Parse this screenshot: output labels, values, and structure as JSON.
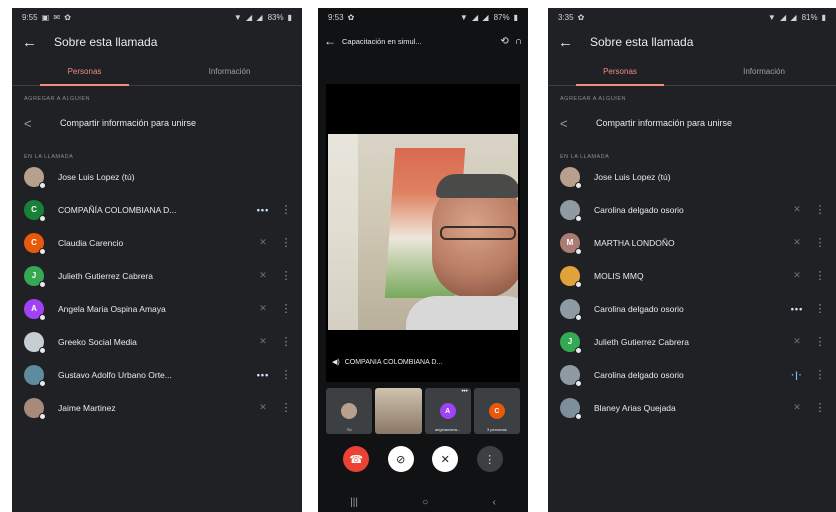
{
  "colors": {
    "background": "#202124",
    "accent": "#f28b82",
    "end_call": "#ea4335",
    "speaking": "#8ab4f8"
  },
  "left": {
    "status": {
      "time": "9:55",
      "battery": "83%"
    },
    "title": "Sobre esta llamada",
    "tabs": [
      "Personas",
      "Información"
    ],
    "add_label": "AGREGAR A ALGUIEN",
    "share_text": "Compartir información para unirse",
    "in_call_label": "EN LA LLAMADA",
    "participants": [
      {
        "name": "Jose Luis Lopez (tú)",
        "initial": "",
        "color": "#b7a08e",
        "status": "",
        "icon": "photo-avatar"
      },
      {
        "name": "COMPAÑÍA COLOMBIANA D...",
        "initial": "C",
        "color": "#188038",
        "status": "•••",
        "icon": "speaking-dots-icon"
      },
      {
        "name": "Claudia Carencio",
        "initial": "C",
        "color": "#e8590c",
        "status": "✕",
        "icon": "mic-off-icon"
      },
      {
        "name": "Julieth Gutierrez Cabrera",
        "initial": "J",
        "color": "#34a853",
        "status": "✕",
        "icon": "mic-off-icon"
      },
      {
        "name": "Angela Maria Ospina Amaya",
        "initial": "A",
        "color": "#a142f4",
        "status": "✕",
        "icon": "mic-off-icon"
      },
      {
        "name": "Greeko Social Media",
        "initial": "",
        "color": "#c7cdd3",
        "status": "✕",
        "icon": "mic-off-icon"
      },
      {
        "name": "Gustavo Adolfo Urbano Orte...",
        "initial": "",
        "color": "#5f8b9e",
        "status": "•••",
        "icon": "speaking-dots-icon"
      },
      {
        "name": "Jaime Martinez",
        "initial": "",
        "color": "#a78a7a",
        "status": "✕",
        "icon": "mic-off-icon"
      }
    ]
  },
  "mid": {
    "status": {
      "time": "9:53",
      "battery": "87%"
    },
    "title": "Capacitación en simul...",
    "video_label": "COMPAÑÍA COLOMBIANA D...",
    "thumbs": [
      {
        "label": "Tú"
      },
      {
        "label": ""
      },
      {
        "initial": "A",
        "color": "#a142f4",
        "label": "angelamaria..."
      },
      {
        "initial": "C",
        "color": "#e8590c",
        "label": "3 personas"
      }
    ]
  },
  "right": {
    "status": {
      "time": "3:35",
      "battery": "81%"
    },
    "title": "Sobre esta llamada",
    "tabs": [
      "Personas",
      "Información"
    ],
    "add_label": "AGREGAR A ALGUIEN",
    "share_text": "Compartir información para unirse",
    "in_call_label": "EN LA LLAMADA",
    "participants": [
      {
        "name": "Jose Luis Lopez (tú)",
        "initial": "",
        "color": "#b7a08e",
        "status": "",
        "icon": "photo-avatar"
      },
      {
        "name": "Carolina delgado osorio",
        "initial": "",
        "color": "#8f9ba3",
        "status": "✕",
        "icon": "mic-off-icon"
      },
      {
        "name": "MARTHA LONDOÑO",
        "initial": "M",
        "color": "#a97d73",
        "status": "✕",
        "icon": "mic-off-icon"
      },
      {
        "name": "MOLIS MMQ",
        "initial": "",
        "color": "#e0a33a",
        "status": "✕",
        "icon": "mic-off-icon"
      },
      {
        "name": "Carolina delgado osorio",
        "initial": "",
        "color": "#8f9ba3",
        "status": "•••",
        "icon": "speaking-dots-icon"
      },
      {
        "name": "Julieth Gutierrez Cabrera",
        "initial": "J",
        "color": "#34a853",
        "status": "✕",
        "icon": "mic-off-icon"
      },
      {
        "name": "Carolina delgado osorio",
        "initial": "",
        "color": "#8f9ba3",
        "status": "·|·",
        "icon": "speaking-bars-icon"
      },
      {
        "name": "Blaney Arias Quejada",
        "initial": "",
        "color": "#7e8f9b",
        "status": "✕",
        "icon": "mic-off-icon"
      }
    ]
  }
}
